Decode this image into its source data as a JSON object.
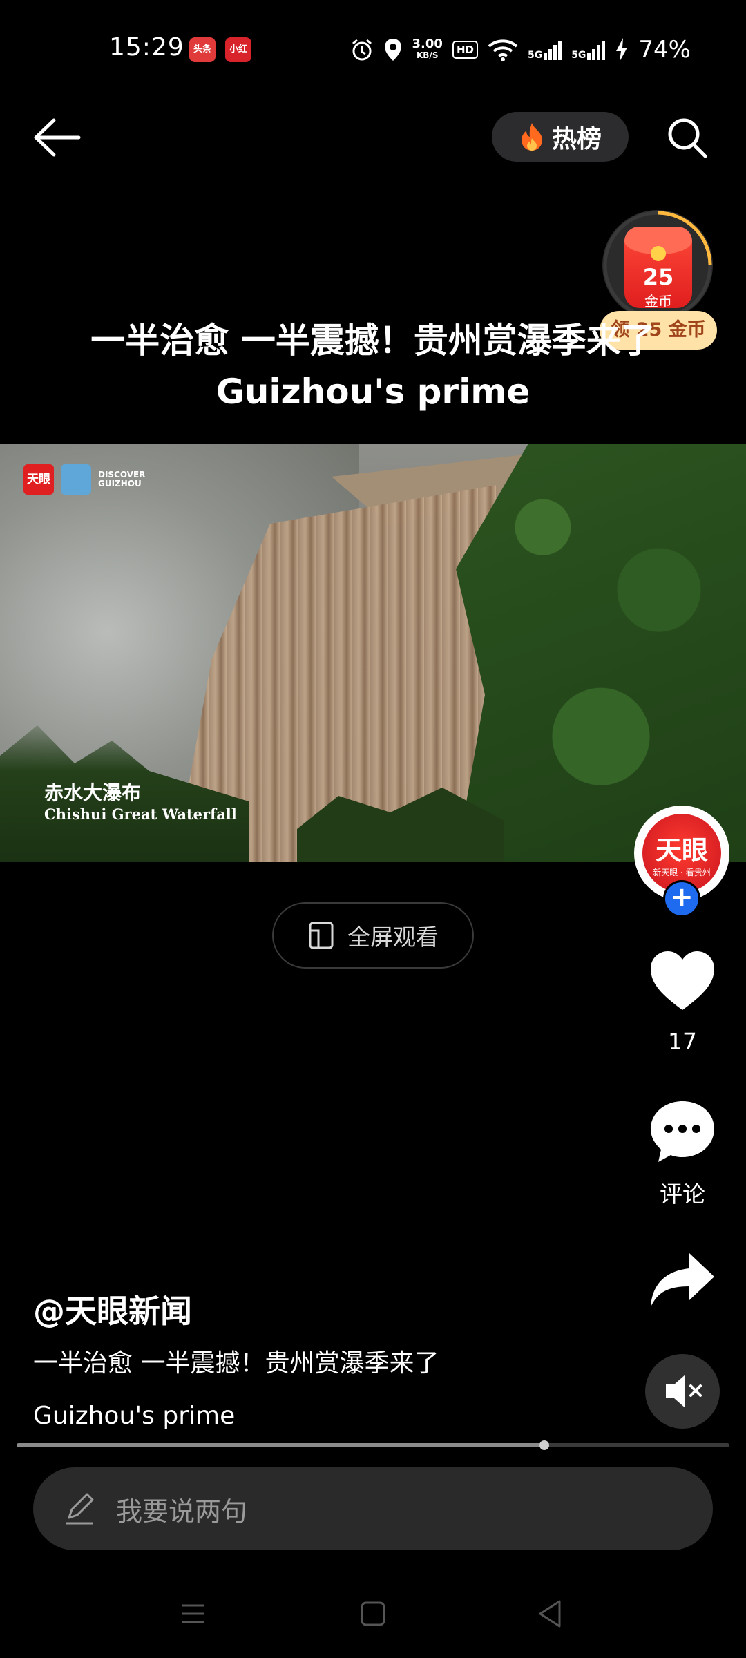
{
  "status_bar": {
    "time": "15:29",
    "app_icons": [
      "头条",
      "小红书"
    ],
    "speed_value": "3.00",
    "speed_unit": "KB/S",
    "hd_label": "HD",
    "net1": "5G",
    "net2": "5G",
    "battery": "74%"
  },
  "header": {
    "hot_label": "热榜"
  },
  "coin_badge": {
    "amount": "25",
    "unit": "金币",
    "cta": "领 25 金币"
  },
  "video": {
    "title_line1": "一半治愈 一半震撼！贵州赏瀑季来了",
    "title_line2": "Guizhou's prime",
    "overlay_logo_1": "天眼",
    "overlay_logo_2": "DISCOVER",
    "overlay_logo_3": "GUIZHOU",
    "caption_zh": "赤水大瀑布",
    "caption_en": "Chishui Great Waterfall",
    "fullscreen_label": "全屏观看",
    "progress": 0.74
  },
  "sidebar": {
    "avatar_text": "天眼",
    "avatar_sub": "新天眼 · 看贵州",
    "like_count": "17",
    "comment_label": "评论"
  },
  "post": {
    "author": "@天眼新闻",
    "desc_line1": "一半治愈 一半震撼！贵州赏瀑季来了",
    "desc_line2": "Guizhou's prime"
  },
  "comment_input": {
    "placeholder": "我要说两句"
  },
  "colors": {
    "background": "#000000",
    "follow_blue": "#1e6bf0",
    "coin_red": "#e01e1e",
    "coin_pill": "#ffe2a8"
  }
}
